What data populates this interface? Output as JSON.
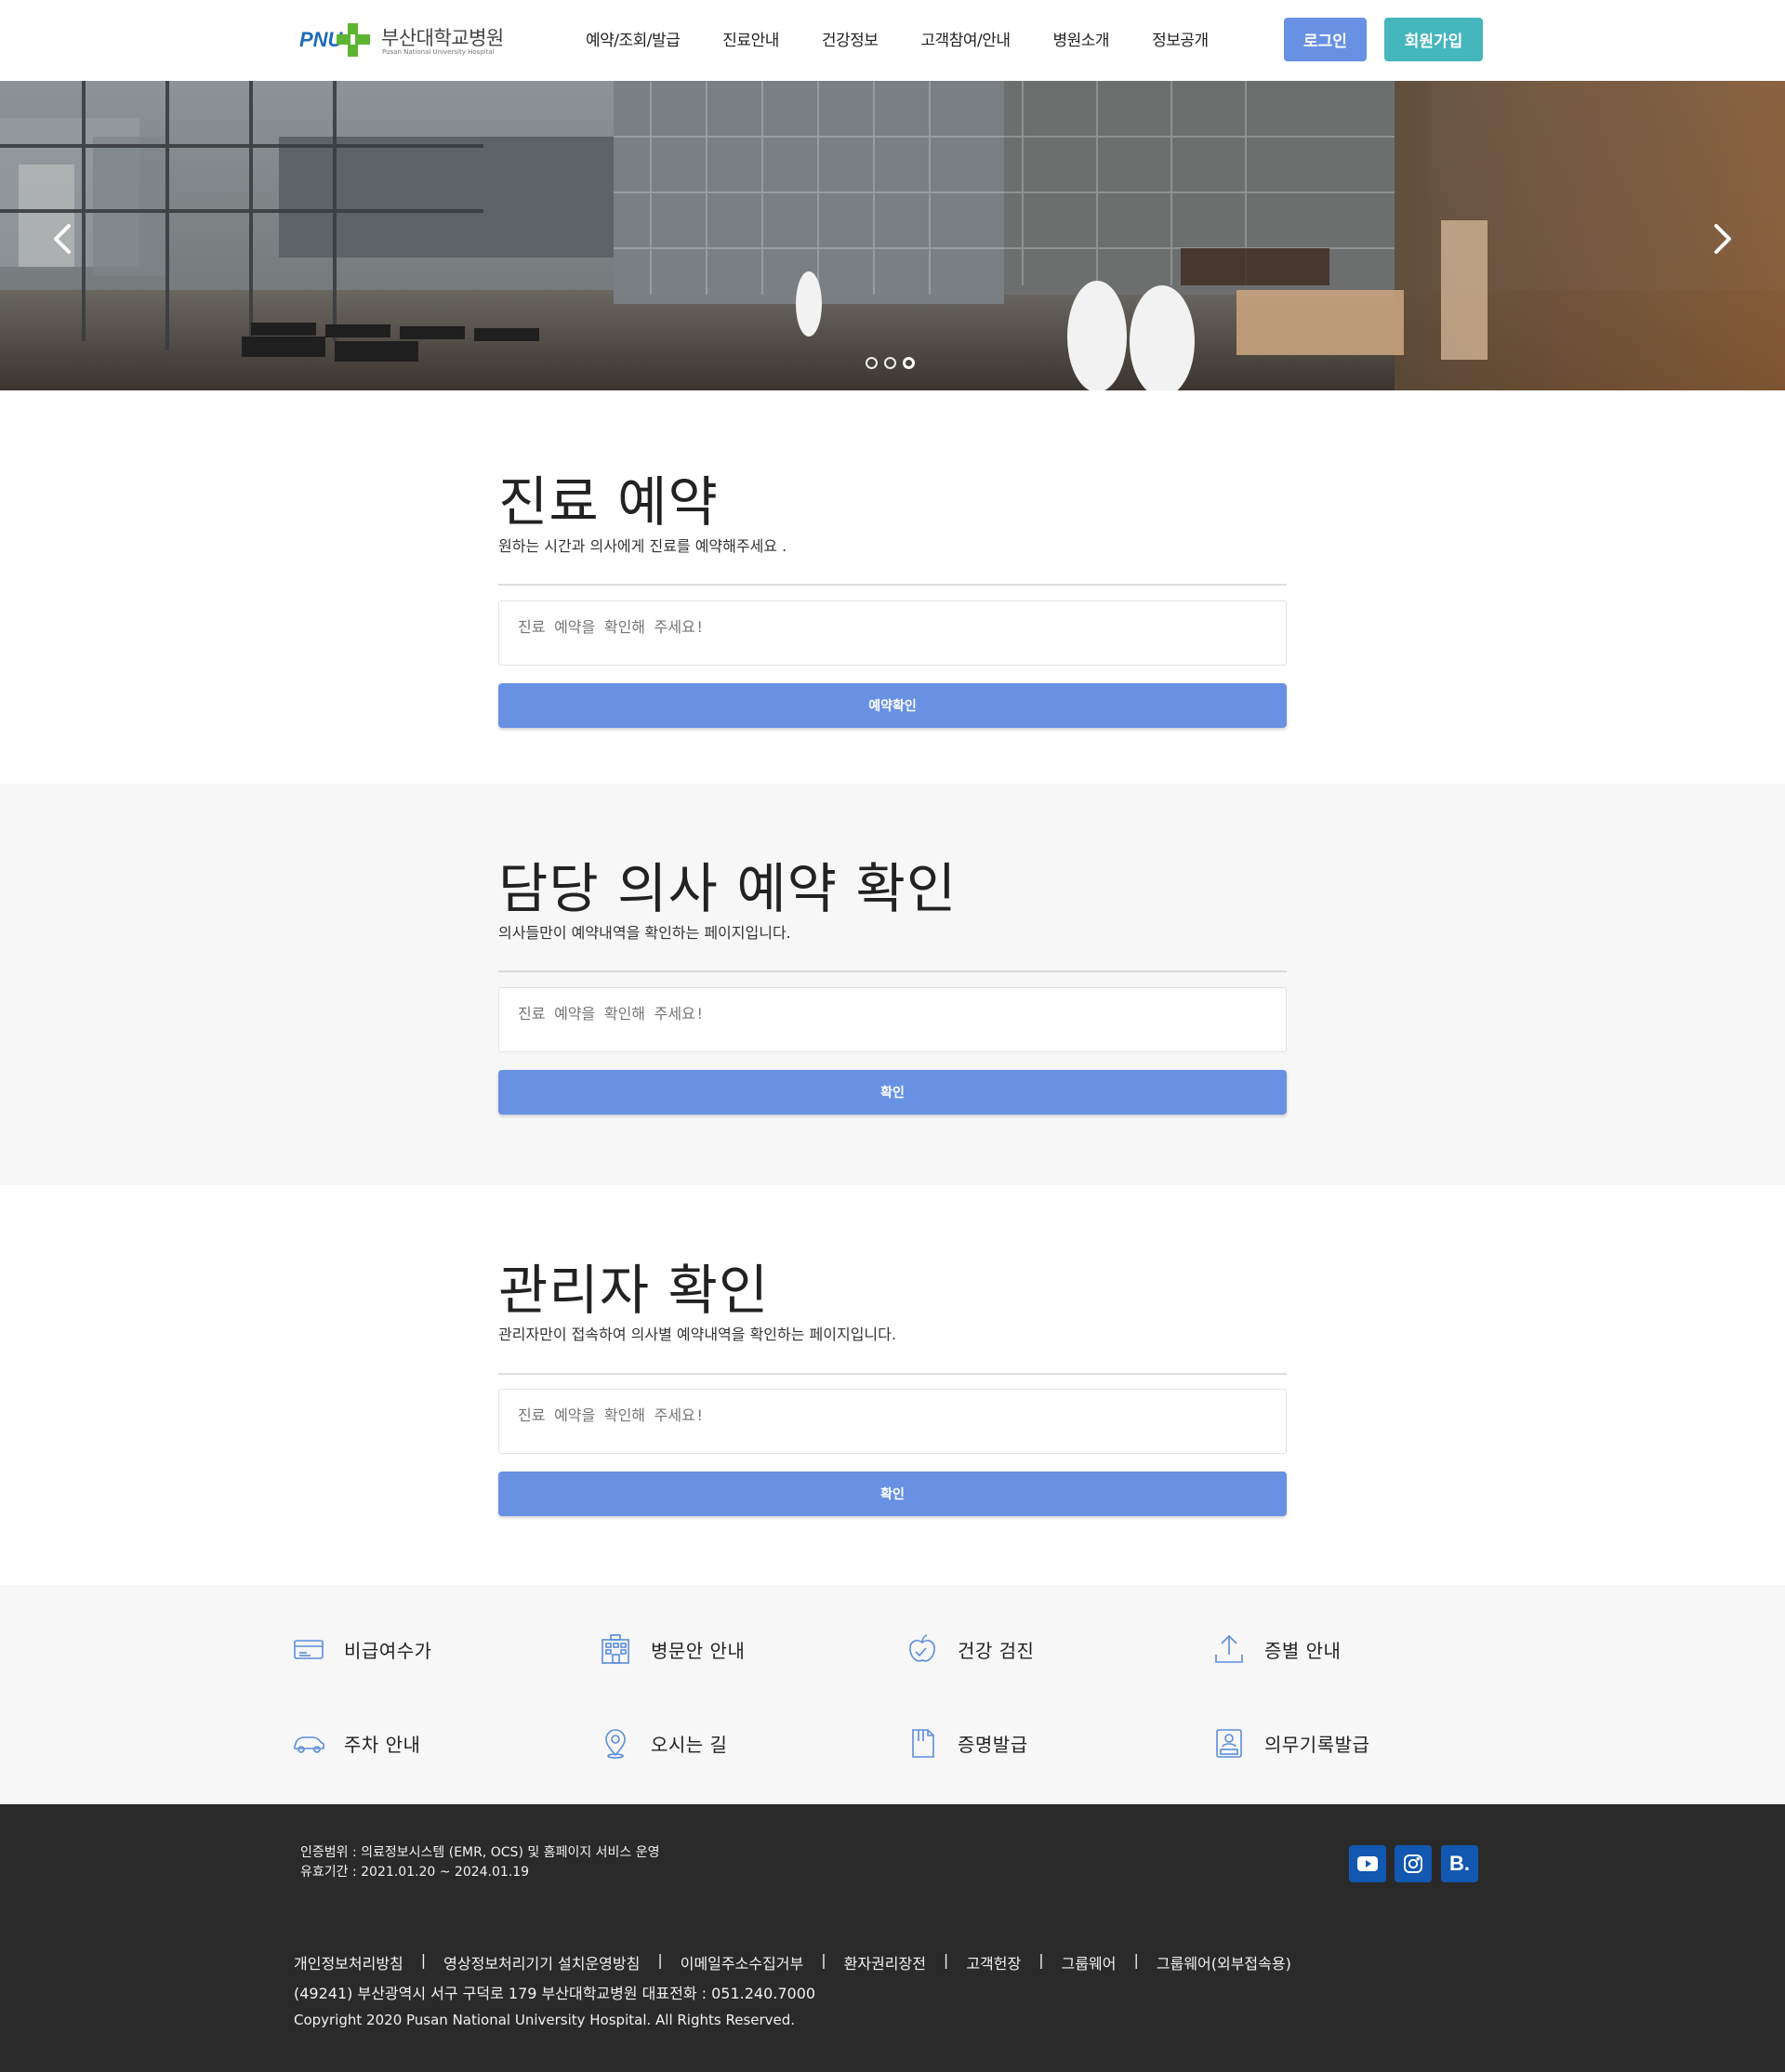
{
  "header": {
    "logo_mark": "PNU",
    "logo_text": "부산대학교병원",
    "logo_sub": "Pusan National University Hospital",
    "nav": [
      "예약/조회/발급",
      "진료안내",
      "건강정보",
      "고객참여/안내",
      "병원소개",
      "정보공개"
    ],
    "login_label": "로그인",
    "join_label": "회원가입"
  },
  "hero": {
    "slide_count": 3,
    "active_slide": 3
  },
  "sections": [
    {
      "title": "진료 예약",
      "desc": "원하는 시간과 의사에게 진료를 예약해주세요 .",
      "placeholder": "진료 예약을 확인해 주세요!",
      "button": "예약확인"
    },
    {
      "title": "담당 의사 예약 확인",
      "desc": "의사들만이 예약내역을 확인하는 페이지입니다.",
      "placeholder": "진료 예약을 확인해 주세요!",
      "button": "확인"
    },
    {
      "title": "관리자 확인",
      "desc": "관리자만이 접속하여 의사별 예약내역을 확인하는 페이지입니다.",
      "placeholder": "진료 예약을 확인해 주세요!",
      "button": "확인"
    }
  ],
  "quick_links": [
    {
      "label": "비급여수가",
      "icon": "card-icon"
    },
    {
      "label": "병문안 안내",
      "icon": "building-icon"
    },
    {
      "label": "건강 검진",
      "icon": "apple-icon"
    },
    {
      "label": "증별 안내",
      "icon": "upload-icon"
    },
    {
      "label": "주차 안내",
      "icon": "car-icon"
    },
    {
      "label": "오시는 길",
      "icon": "map-pin-icon"
    },
    {
      "label": "증명발급",
      "icon": "document-icon"
    },
    {
      "label": "의무기록발급",
      "icon": "record-icon"
    }
  ],
  "footer": {
    "cert_line1": "인증범위 : 의료정보시스템 (EMR, OCS) 및 홈페이지 서비스 운영",
    "cert_line2": "유효기간 : 2021.01.20 ~ 2024.01.19",
    "social": [
      {
        "name": "youtube-icon"
      },
      {
        "name": "instagram-icon"
      },
      {
        "name": "blog-icon",
        "text": "B."
      }
    ],
    "links": [
      "개인정보처리방침",
      "영상정보처리기기 설치운영방침",
      "이메일주소수집거부",
      "환자권리장전",
      "고객헌장",
      "그룹웨어",
      "그룹웨어(외부접속용)"
    ],
    "separator": "|",
    "address": "(49241) 부산광역시 서구 구덕로 179 부산대학교병원 대표전화 : 051.240.7000",
    "copyright": "Copyright 2020 Pusan National University Hospital. All Rights Reserved."
  },
  "colors": {
    "primary": "#6891e4",
    "teal": "#45b6bb",
    "footer_bg": "#2a2a2a",
    "social_bg": "#1257b0",
    "logo_blue": "#1d6cb5",
    "logo_green": "#5cb531"
  }
}
